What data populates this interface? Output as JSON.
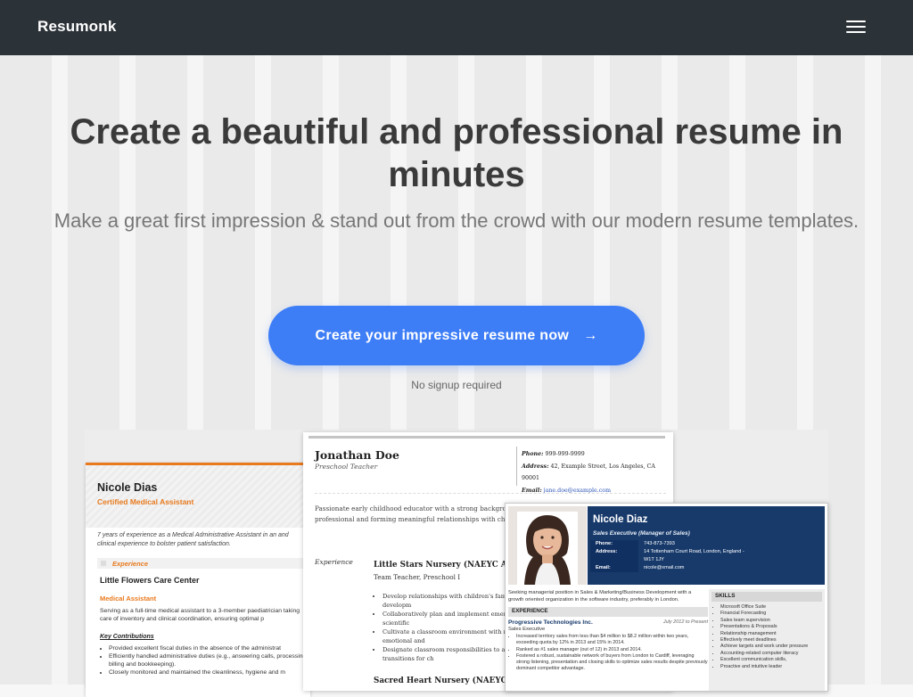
{
  "nav": {
    "brand": "Resumonk",
    "menu_icon": "hamburger-icon"
  },
  "hero": {
    "title": "Create a beautiful and professional resume in minutes",
    "subtitle": "Make a great first impression & stand out from the crowd with our modern resume templates.",
    "cta_label": "Create your impressive resume now",
    "cta_arrow": "→",
    "note": "No signup required"
  },
  "colors": {
    "nav_bg": "#2b3238",
    "cta_bg": "#3d7df6",
    "accent_orange": "#e8791d",
    "accent_navy": "#173a6b"
  },
  "resume1": {
    "name": "Nicole Dias",
    "title": "Certified Medical Assistant",
    "summary": "7 years of experience as a Medical Administrative Assistant in an and clinical experience to bolster patient satisfaction.",
    "section": "Experience",
    "company": "Little Flowers Care Center",
    "role": "Medical Assistant",
    "description": "Serving as a full-time medical assistant to a 3-member paediatrician taking care of inventory and clinical coordination, ensuring optimal p",
    "contrib_heading": "Key Contributions",
    "bullets": [
      "Provided excellent fiscal duties in the absence of the administrat",
      "Efficiently handled administrative duties (e.g., answering calls, processing, billing and bookkeeping).",
      "Closely monitored and maintained the cleanliness, hygiene and m"
    ]
  },
  "resume2": {
    "name": "Jonathan Doe",
    "title": "Preschool Teacher",
    "phone_label": "Phone:",
    "phone": "999-999-9999",
    "address_label": "Address:",
    "address": "42, Example Street, Los Angeles, CA 90001",
    "email_label": "Email:",
    "email": "jane.doe@example.com",
    "summary": "Passionate early childhood educator with a strong backgrou through emergent curriculum. Detail-oriented professional and forming meaningful relationships with children & famil",
    "section": "Experience",
    "org": "Little Stars Nursery (NAEYC Acc",
    "role": "Team Teacher, Preschool I",
    "bullets": [
      "Develop relationships with children's families in co home environment, and optimally support developm",
      "Collaboratively plan and implement emergent curric literacy skills, mathematical concepts and scientific",
      "Cultivate a classroom environment with multi-sens promote children's cognitive, social-emotional and",
      "Designate classroom responsibilities to assistant te classroom activities, routines and transitions for ch"
    ],
    "org2": "Sacred Heart Nursery (NAEYC A"
  },
  "resume3": {
    "name": "Nicole Diaz",
    "title": "Sales Executive (Manager of Sales)",
    "phone_label": "Phone:",
    "phone": "743-873-7393",
    "address_label": "Address:",
    "address": "14 Tottenham Court Road, London, England - W1T 1JY",
    "email_label": "Email:",
    "email": "nicole@xmail.com",
    "summary": "Seeking managerial position in Sales & Marketing/Business Development with a growth oriented organization in the software industry, preferably in London.",
    "exp_heading": "EXPERIENCE",
    "company": "Progressive Technologies Inc.",
    "dates": "July 2012 to Present",
    "role": "Sales Executive",
    "bullets": [
      "Increased territory sales from less than $4 million to $8.2 million within two years, exceeding quota by 12% in 2013 and 15% in 2014.",
      "Ranked as #1 sales manager (out of 12) in 2013 and 2014.",
      "Fostered a robust, sustainable network of buyers from London to Cardiff, leveraging strong listening, presentation and closing skills to optimize sales results despite previously dominant competitor advantage."
    ],
    "skills_heading": "SKILLS",
    "skills": [
      "Microsoft Office Suite",
      "Financial Forecasting",
      "Sales team supervision",
      "Presentations & Proposals",
      "Relationship management",
      "Effectively meet deadlines",
      "Achieve targets and work under pressure",
      "Accounting-related computer literacy",
      "Excellent communication skills,",
      "Proactive and intuitive leader"
    ]
  }
}
